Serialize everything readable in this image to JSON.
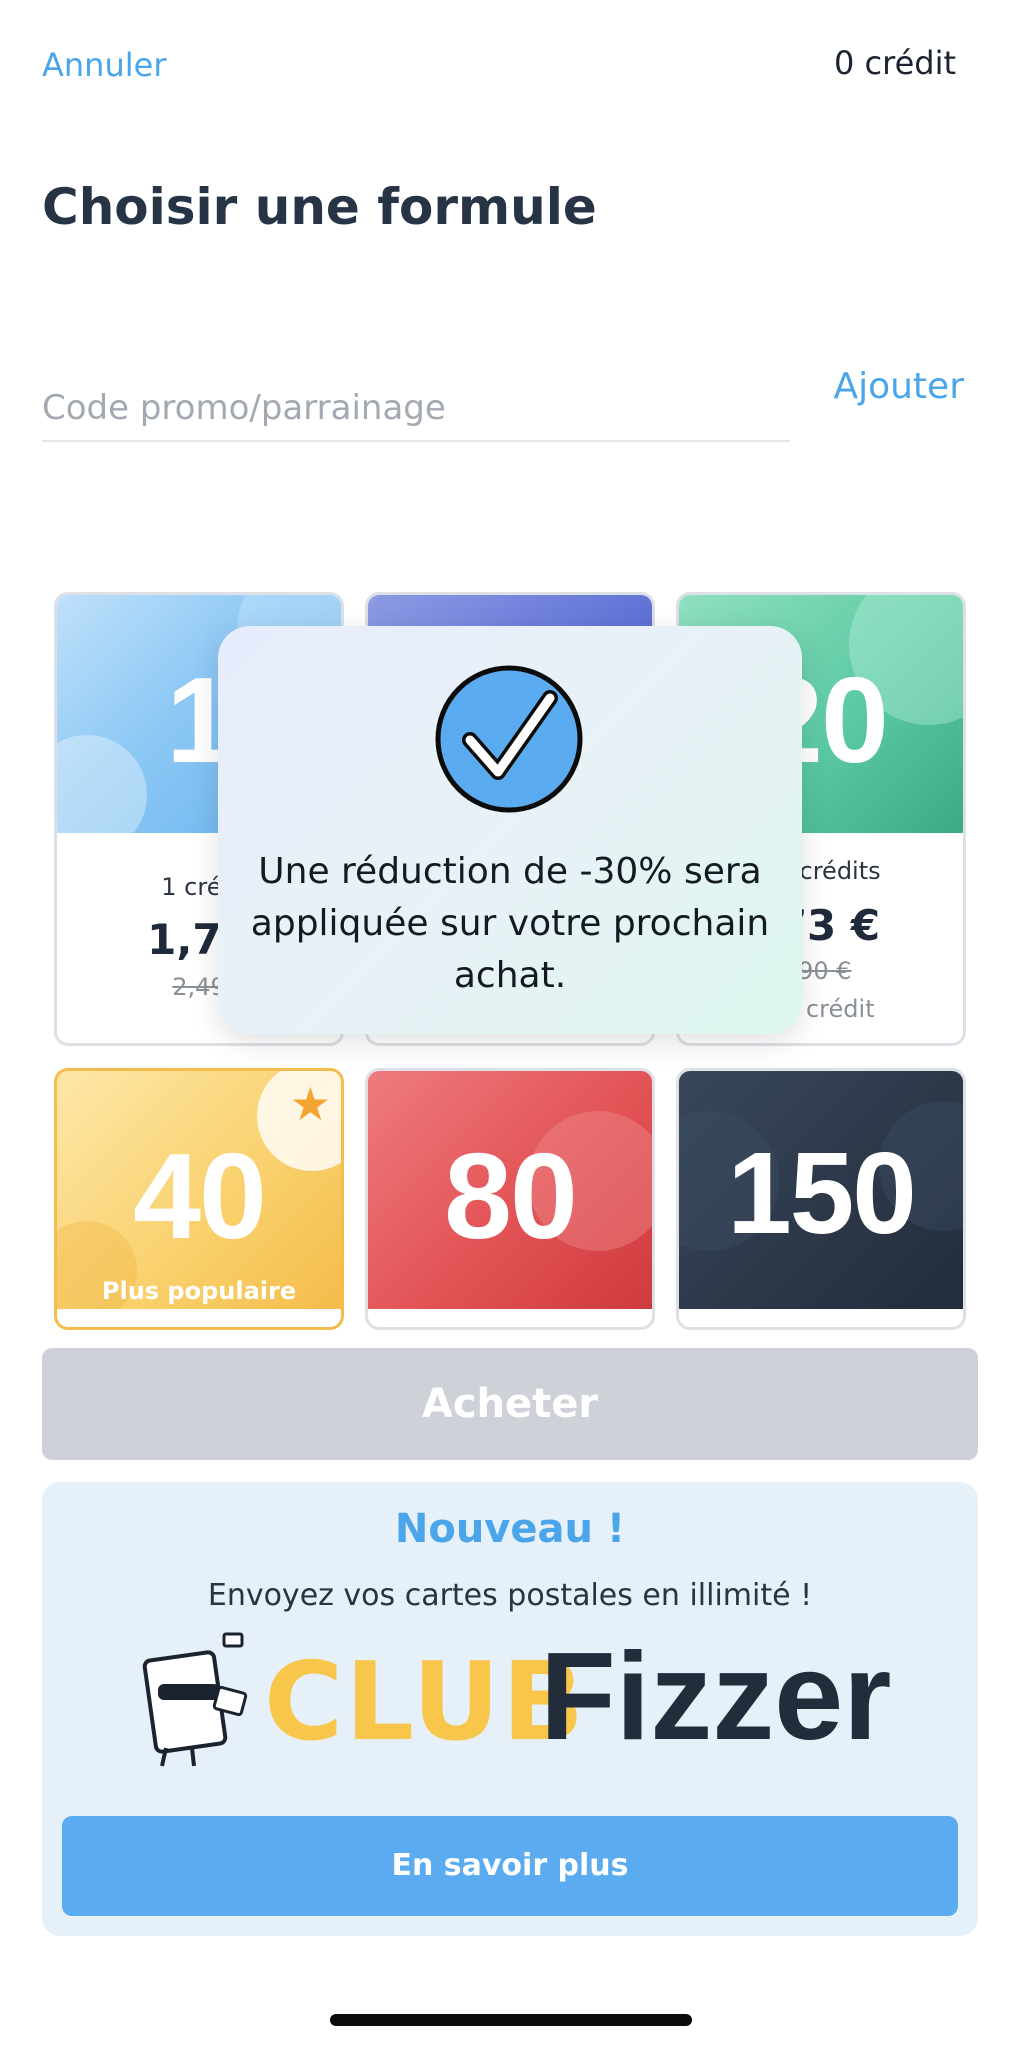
{
  "header": {
    "cancel_label": "Annuler",
    "credits_label": "0 crédit"
  },
  "page_title": "Choisir une formule",
  "promo": {
    "placeholder": "Code promo/parrainage",
    "add_label": "Ajouter"
  },
  "offers": [
    {
      "number": "1",
      "label": "1 créd",
      "price": "1,74",
      "old_price": "2,49",
      "unit": ""
    },
    {
      "number": "",
      "label": "",
      "price": "",
      "old_price": "",
      "unit": ""
    },
    {
      "number": "20",
      "label": "20 crédits",
      "price": ",73 €",
      "old_price": ",90 €",
      "unit": "€ / crédit"
    },
    {
      "number": "40",
      "badge": "Plus populaire"
    },
    {
      "number": "80"
    },
    {
      "number": "150"
    }
  ],
  "popup": {
    "message": "Une réduction de -30% sera appliquée sur votre prochain achat."
  },
  "buy_label": "Acheter",
  "club": {
    "new_label": "Nouveau !",
    "subtitle": "Envoyez vos cartes postales en illimité !",
    "logo_club": "CLUB",
    "logo_fizzer": "Fizzer",
    "more_label": "En savoir plus"
  },
  "colors": {
    "accent": "#4aa5ea",
    "button_primary": "#5aabef",
    "button_disabled": "#ced2d8",
    "title": "#263445"
  }
}
